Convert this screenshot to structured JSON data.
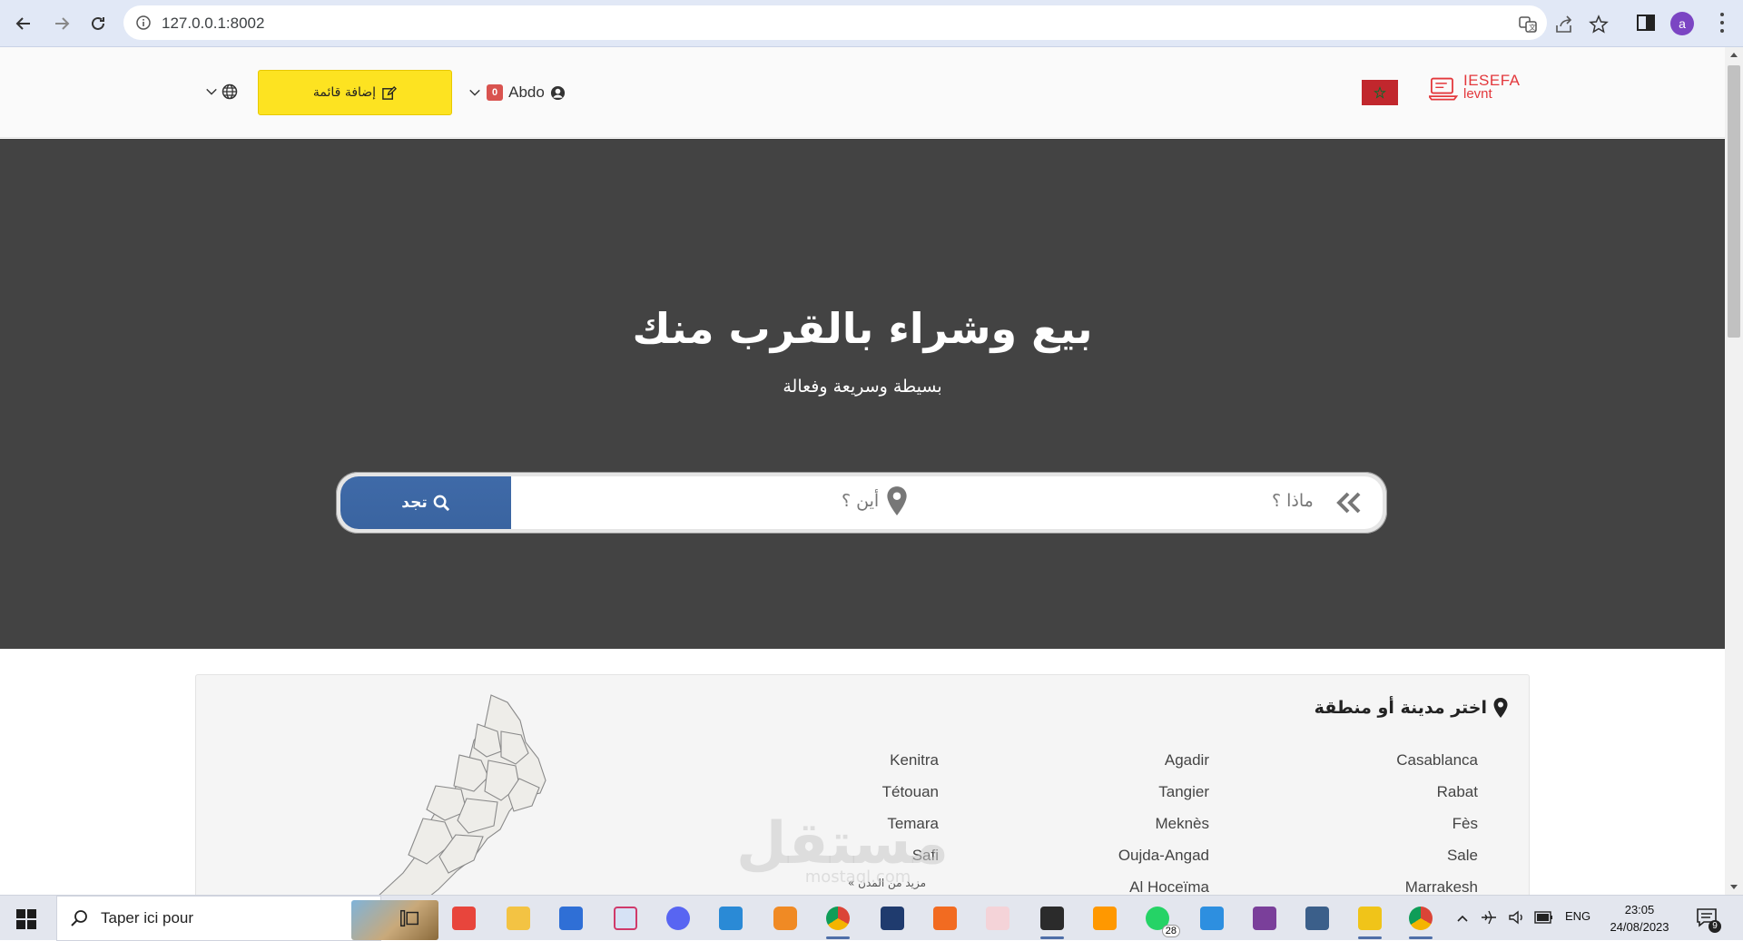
{
  "browser": {
    "url": "127.0.0.1:8002",
    "profile_initial": "a"
  },
  "header": {
    "add_listing_label": "إضافة قائمة",
    "username": "Abdo",
    "cart_count": "0",
    "logo_line1": "IESEFA",
    "logo_line2": "levnt",
    "colors": {
      "accent_yellow": "#fde321",
      "badge_red": "#d9534f",
      "logo_red": "#e3373b"
    }
  },
  "hero": {
    "title": "بيع وشراء بالقرب منك",
    "subtitle": "بسيطة وسريعة وفعالة",
    "what_placeholder": "ماذا ؟",
    "where_placeholder": "أين ؟",
    "search_button": "تجد",
    "colors": {
      "background": "#434343",
      "button_blue": "#3d67a4"
    }
  },
  "cities": {
    "title": "اختر مدينة أو منطقة",
    "columns": [
      [
        "Casablanca",
        "Rabat",
        "Fès",
        "Sale",
        "Marrakesh"
      ],
      [
        "Agadir",
        "Tangier",
        "Meknès",
        "Oujda-Angad",
        "Al Hoceïma"
      ],
      [
        "Kenitra",
        "Tétouan",
        "Temara",
        "Safi"
      ]
    ],
    "more_link": "مزيد من المدن »"
  },
  "watermark": {
    "line1": "مستقل",
    "line2": "mostaql.com"
  },
  "taskbar": {
    "search_text": "Taper ici pour",
    "whatsapp_count": "28",
    "language": "ENG",
    "time": "23:05",
    "date": "24/08/2023",
    "notification_count": "9"
  }
}
